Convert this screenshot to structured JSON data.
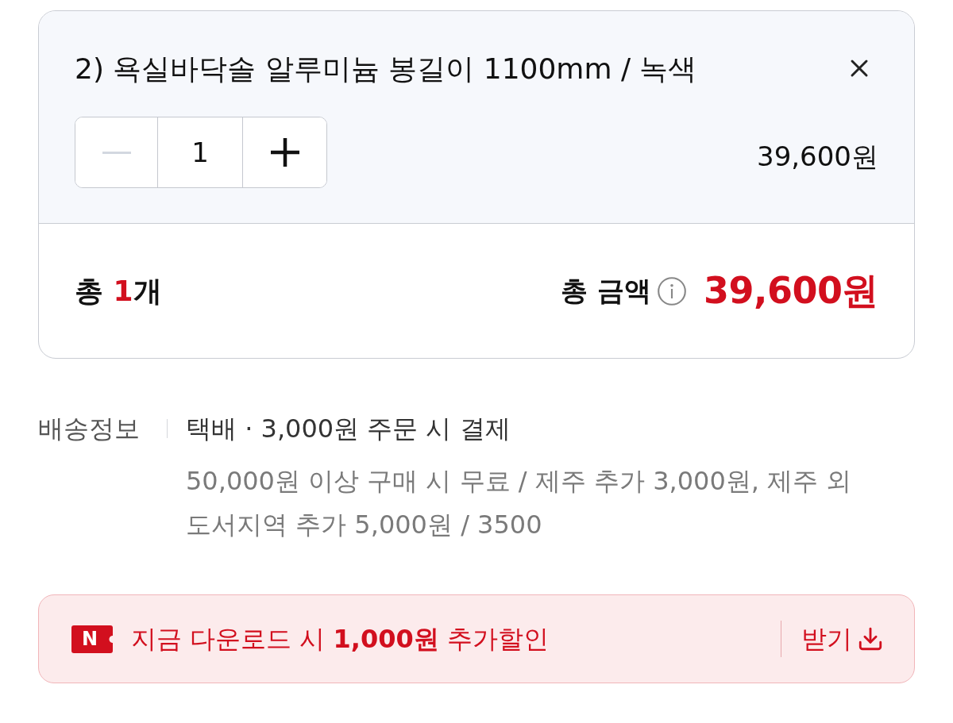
{
  "cart_item": {
    "title": "2) 욕실바닥솔 알루미늄 봉길이 1100mm / 녹색",
    "quantity": {
      "value": "1",
      "decrease": {
        "disabled": true
      },
      "increase": {
        "disabled": false
      }
    },
    "price": "39,600원"
  },
  "total": {
    "count_label": "총",
    "count": "1",
    "count_unit": "개",
    "amount_label": "총 금액",
    "amount": "39,600원"
  },
  "shipping": {
    "label": "배송정보",
    "method": "택배 · 3,000원 주문 시 결제",
    "details": "50,000원 이상 구매 시 무료 / 제주 추가 3,000원, 제주 외 도서지역 추가 5,000원 / 3500"
  },
  "coupon": {
    "tag": "N",
    "message": "지금 다운로드 시 **1,000원** 추가할인",
    "action": "받기"
  }
}
